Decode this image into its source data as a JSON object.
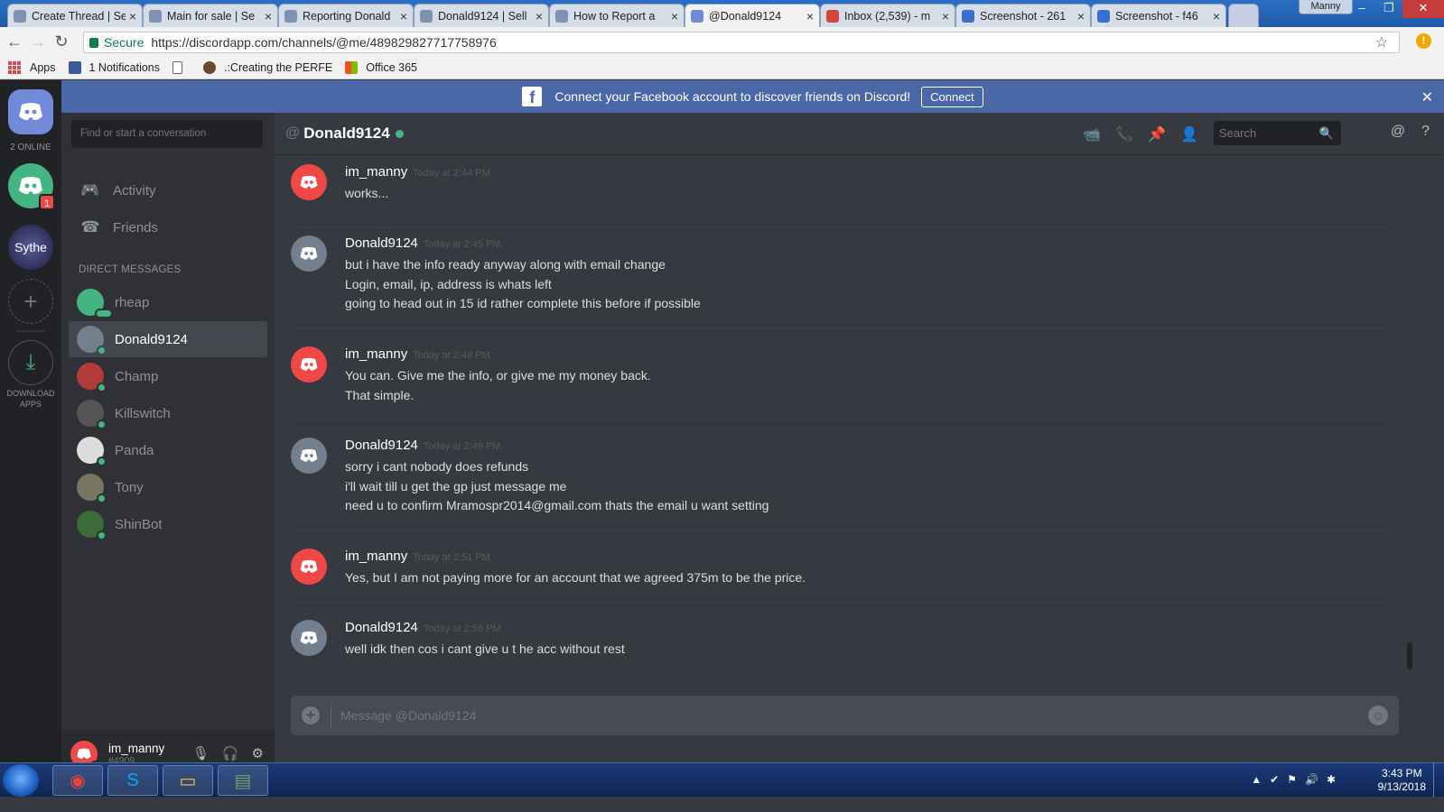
{
  "browser": {
    "tabs": [
      {
        "label": "Create Thread | Se",
        "icon": "shield-icon",
        "icon_color": "#7f93b0"
      },
      {
        "label": "Main for sale | Se",
        "icon": "shield-icon",
        "icon_color": "#7f93b0"
      },
      {
        "label": "Reporting Donald",
        "icon": "shield-icon",
        "icon_color": "#7f93b0"
      },
      {
        "label": "Donald9124 | Sell",
        "icon": "shield-icon",
        "icon_color": "#7f93b0"
      },
      {
        "label": "How to Report a",
        "icon": "shield-icon",
        "icon_color": "#7f93b0"
      },
      {
        "label": "@Donald9124",
        "icon": "discord-icon",
        "icon_color": "#7289da",
        "active": true
      },
      {
        "label": "Inbox (2,539) - m",
        "icon": "gmail-icon",
        "icon_color": "#d44638"
      },
      {
        "label": "Screenshot - 261",
        "icon": "screenshot-icon",
        "icon_color": "#3b6fcf"
      },
      {
        "label": "Screenshot - f46",
        "icon": "screenshot-icon",
        "icon_color": "#3b6fcf"
      }
    ],
    "tab_close": "×",
    "profile_name": "Manny",
    "window_buttons": {
      "minimize": "–",
      "maximize": "❐",
      "close": "✕"
    },
    "nav": {
      "back": "←",
      "forward": "→",
      "reload": "↻"
    },
    "secure_label": "Secure",
    "url": "https://discordapp.com/channels/@me/489829827717758976",
    "star": "☆",
    "warning": "!",
    "bookmarks": [
      {
        "label": "Apps",
        "icon": "apps-grid-icon"
      },
      {
        "label": "1 Notifications",
        "icon": "facebook-icon",
        "icon_color": "#3b5998"
      },
      {
        "label": "",
        "icon": "page-icon"
      },
      {
        "label": ".:Creating the PERFE",
        "icon": "avatar-icon",
        "icon_color": "#6b4a2a"
      },
      {
        "label": "Office 365",
        "icon": "office-icon"
      }
    ]
  },
  "discord": {
    "banner": {
      "text": "Connect your Facebook account to discover friends on Discord!",
      "button": "Connect",
      "icon": "f",
      "close": "✕"
    },
    "guilds": {
      "online_count": "2 ONLINE",
      "server_badge": "1",
      "sythe_label": "Sythe",
      "add": "+",
      "download_label": "DOWNLOAD APPS",
      "download_icon": "⤓"
    },
    "sidebar": {
      "search_placeholder": "Find or start a conversation",
      "nav": [
        {
          "label": "Activity",
          "icon": "🎮"
        },
        {
          "label": "Friends",
          "icon": "☎"
        }
      ],
      "dm_header": "DIRECT MESSAGES",
      "dms": [
        {
          "name": "rheap",
          "avatar_color": "#43b581",
          "status": "typing"
        },
        {
          "name": "Donald9124",
          "avatar_color": "#747f8d",
          "status": "online",
          "active": true
        },
        {
          "name": "Champ",
          "avatar_color": "#b33a3a",
          "status": "online"
        },
        {
          "name": "Killswitch",
          "avatar_color": "#555",
          "status": "online"
        },
        {
          "name": "Panda",
          "avatar_color": "#ddd",
          "status": "online"
        },
        {
          "name": "Tony",
          "avatar_color": "#7a7563",
          "status": "online"
        },
        {
          "name": "ShinBot",
          "avatar_color": "#3c6b3a",
          "status": "online"
        }
      ],
      "user": {
        "name": "im_manny",
        "tag": "#4909"
      },
      "user_icons": {
        "mic": "🎙",
        "headphones": "🎧",
        "settings": "⚙"
      }
    },
    "chat": {
      "at": "@",
      "channel": "Donald9124",
      "header_icons": {
        "video": "📹",
        "call": "📞",
        "pin": "📌",
        "add_friend": "👤"
      },
      "search_placeholder": "Search",
      "search_icon": "🔍",
      "mention": "@",
      "help": "?",
      "messages": [
        {
          "author": "im_manny",
          "time": "Today at 2:44 PM",
          "avatar_color": "#f04747",
          "lines": [
            "works..."
          ]
        },
        {
          "author": "Donald9124",
          "time": "Today at 2:45 PM",
          "avatar_color": "#747f8d",
          "lines": [
            "but i have the info ready anyway along with email change",
            "Login, email, ip, address is whats left",
            "going to head out in 15 id rather complete this before if possible"
          ]
        },
        {
          "author": "im_manny",
          "time": "Today at 2:48 PM",
          "avatar_color": "#f04747",
          "lines": [
            "You can. Give me the info, or give me my money back.",
            "That simple."
          ]
        },
        {
          "author": "Donald9124",
          "time": "Today at 2:49 PM",
          "avatar_color": "#747f8d",
          "lines": [
            "sorry i cant nobody does refunds",
            "i'll wait till u get the gp just message me",
            "need u to confirm Mramospr2014@gmail.com thats the email u want setting"
          ]
        },
        {
          "author": "im_manny",
          "time": "Today at 2:51 PM",
          "avatar_color": "#f04747",
          "lines": [
            "Yes, but I am not paying more for an account that we agreed 375m to be the price."
          ]
        },
        {
          "author": "Donald9124",
          "time": "Today at 2:56 PM",
          "avatar_color": "#747f8d",
          "lines": [
            "well idk then cos i cant give u t he acc without rest"
          ]
        }
      ],
      "composer_placeholder": "Message @Donald9124",
      "composer_plus": "+",
      "emoji": "☺"
    }
  },
  "taskbar": {
    "apps": [
      {
        "name": "chrome",
        "icon": "◉",
        "color": "#e8453c"
      },
      {
        "name": "skype",
        "icon": "S",
        "color": "#00aff0"
      },
      {
        "name": "explorer",
        "icon": "▭",
        "color": "#f4c542"
      },
      {
        "name": "monitor",
        "icon": "▤",
        "color": "#6fa36f"
      }
    ],
    "tray": [
      "▲",
      "✔",
      "⚑",
      "🔊",
      "✱"
    ],
    "time": "3:43 PM",
    "date": "9/13/2018"
  }
}
